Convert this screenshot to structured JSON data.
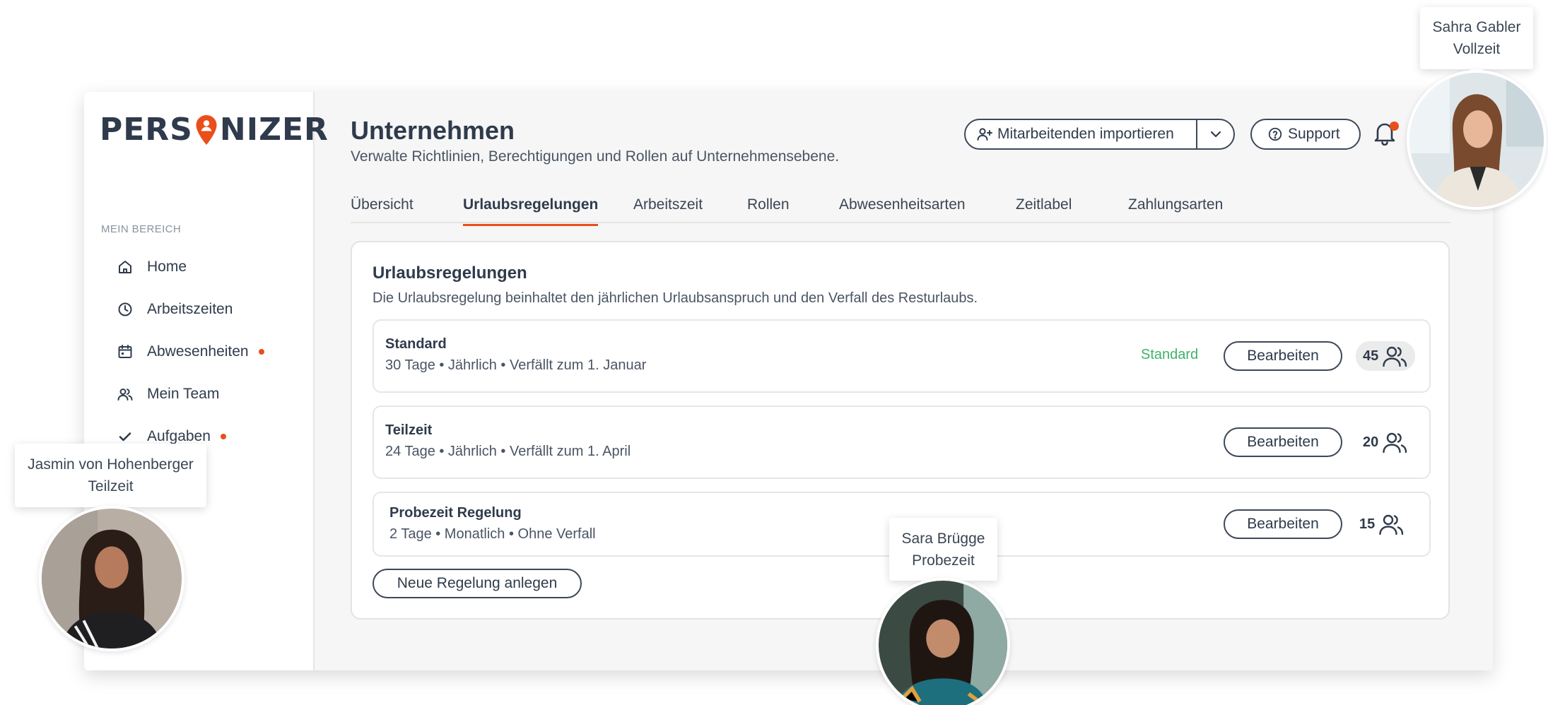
{
  "brand": {
    "logo_left": "PERS",
    "logo_right": "NIZER",
    "accent": "#e94e1b",
    "text": "#2f3b4c",
    "green": "#3fb26b"
  },
  "sidebar": {
    "section_label": "MEIN BEREICH",
    "items": [
      {
        "label": "Home",
        "icon": "home-icon",
        "dot": false
      },
      {
        "label": "Arbeitszeiten",
        "icon": "clock-icon",
        "dot": false
      },
      {
        "label": "Abwesenheiten",
        "icon": "calendar-icon",
        "dot": true
      },
      {
        "label": "Mein Team",
        "icon": "team-icon",
        "dot": false
      },
      {
        "label": "Aufgaben",
        "icon": "check-icon",
        "dot": true
      }
    ]
  },
  "header": {
    "title": "Unternehmen",
    "subtitle": "Verwalte Richtlinien, Berechtigungen und Rollen auf Unternehmensebene.",
    "import_label": "Mitarbeitenden importieren",
    "support_label": "Support"
  },
  "tabs": [
    "Übersicht",
    "Urlaubsregelungen",
    "Arbeitszeit",
    "Rollen",
    "Abwesenheitsarten",
    "Zeitlabel",
    "Zahlungsarten"
  ],
  "active_tab": "Urlaubsregelungen",
  "card": {
    "title": "Urlaubsregelungen",
    "subtitle": "Die Urlaubsregelung beinhaltet den jährlichen Urlaubsanspruch und den Verfall des Resturlaubs.",
    "rules": [
      {
        "name": "Standard",
        "desc": "30 Tage • Jährlich • Verfällt zum 1. Januar",
        "tag": "Standard",
        "edit_label": "Bearbeiten",
        "count": "45"
      },
      {
        "name": "Teilzeit",
        "desc": "24 Tage • Jährlich • Verfällt zum 1. April",
        "edit_label": "Bearbeiten",
        "count": "20"
      },
      {
        "name": "Probezeit Regelung",
        "desc": "2 Tage • Monatlich • Ohne Verfall",
        "edit_label": "Bearbeiten",
        "count": "15"
      }
    ],
    "new_label": "Neue Regelung anlegen"
  },
  "people": [
    {
      "name": "Sahra Gabler",
      "role": "Vollzeit"
    },
    {
      "name": "Jasmin von Hohenberger",
      "role": "Teilzeit"
    },
    {
      "name": "Sara Brügge",
      "role": "Probezeit"
    }
  ]
}
